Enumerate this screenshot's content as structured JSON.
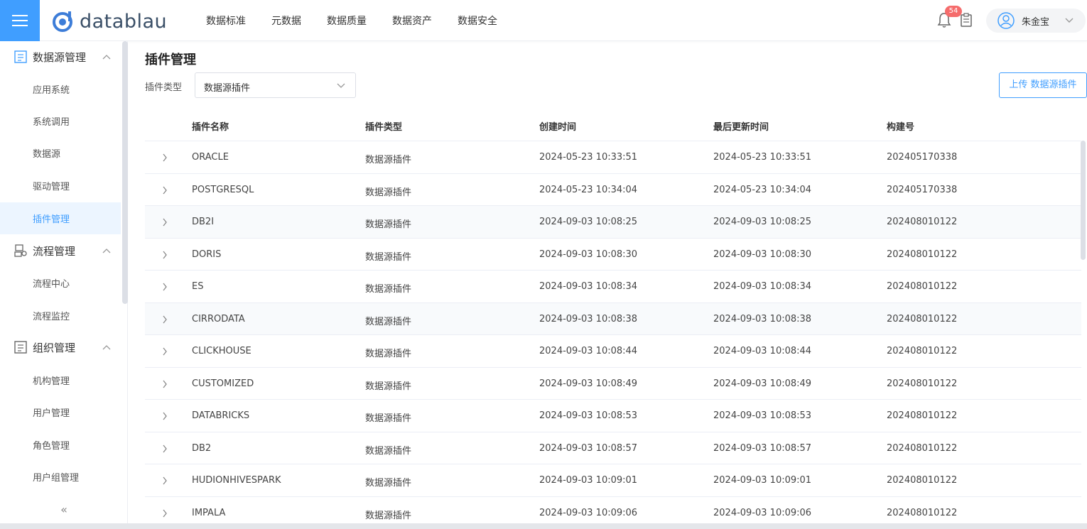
{
  "header": {
    "logo_text": "datablau",
    "nav": [
      "数据标准",
      "元数据",
      "数据质量",
      "数据资产",
      "数据安全"
    ],
    "notification_count": "54",
    "user_name": "朱金宝",
    "accent_color": "#409eff"
  },
  "sidebar": {
    "groups": [
      {
        "label": "数据源管理",
        "icon": "datasource-icon",
        "items": [
          "应用系统",
          "系统调用",
          "数据源",
          "驱动管理",
          "插件管理"
        ]
      },
      {
        "label": "流程管理",
        "icon": "workflow-icon",
        "items": [
          "流程中心",
          "流程监控"
        ]
      },
      {
        "label": "组织管理",
        "icon": "organization-icon",
        "items": [
          "机构管理",
          "用户管理",
          "角色管理",
          "用户组管理"
        ]
      }
    ],
    "active_item": "插件管理",
    "collapse_glyph": "«"
  },
  "main": {
    "title": "插件管理",
    "filter_label": "插件类型",
    "filter_value": "数据源插件",
    "upload_button": "上传 数据源插件",
    "table": {
      "columns": [
        "插件名称",
        "插件类型",
        "创建时间",
        "最后更新时间",
        "构建号"
      ],
      "rows": [
        [
          "ORACLE",
          "数据源插件",
          "2024-05-23 10:33:51",
          "2024-05-23 10:33:51",
          "202405170338"
        ],
        [
          "POSTGRESQL",
          "数据源插件",
          "2024-05-23 10:34:04",
          "2024-05-23 10:34:04",
          "202405170338"
        ],
        [
          "DB2I",
          "数据源插件",
          "2024-09-03 10:08:25",
          "2024-09-03 10:08:25",
          "202408010122"
        ],
        [
          "DORIS",
          "数据源插件",
          "2024-09-03 10:08:30",
          "2024-09-03 10:08:30",
          "202408010122"
        ],
        [
          "ES",
          "数据源插件",
          "2024-09-03 10:08:34",
          "2024-09-03 10:08:34",
          "202408010122"
        ],
        [
          "CIRRODATA",
          "数据源插件",
          "2024-09-03 10:08:38",
          "2024-09-03 10:08:38",
          "202408010122"
        ],
        [
          "CLICKHOUSE",
          "数据源插件",
          "2024-09-03 10:08:44",
          "2024-09-03 10:08:44",
          "202408010122"
        ],
        [
          "CUSTOMIZED",
          "数据源插件",
          "2024-09-03 10:08:49",
          "2024-09-03 10:08:49",
          "202408010122"
        ],
        [
          "DATABRICKS",
          "数据源插件",
          "2024-09-03 10:08:53",
          "2024-09-03 10:08:53",
          "202408010122"
        ],
        [
          "DB2",
          "数据源插件",
          "2024-09-03 10:08:57",
          "2024-09-03 10:08:57",
          "202408010122"
        ],
        [
          "HUDIONHIVESPARK",
          "数据源插件",
          "2024-09-03 10:09:01",
          "2024-09-03 10:09:01",
          "202408010122"
        ],
        [
          "IMPALA",
          "数据源插件",
          "2024-09-03 10:09:06",
          "2024-09-03 10:09:06",
          "202408010122"
        ]
      ]
    }
  }
}
